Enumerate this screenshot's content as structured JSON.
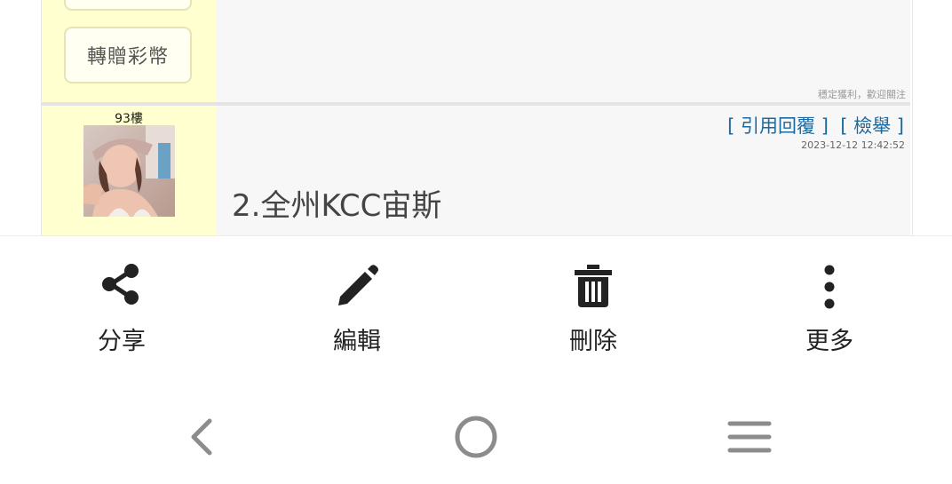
{
  "post_above": {
    "transfer_button": "轉贈彩幣",
    "signature": "穩定獲利，歡迎關注"
  },
  "post": {
    "floor": "93樓",
    "quote_reply": "引用回覆",
    "report": "檢舉",
    "timestamp": "2023-12-12 12:42:52",
    "content": "2.全州KCC宙斯"
  },
  "action_sheet": {
    "items": [
      {
        "label": "分享",
        "icon": "share-icon"
      },
      {
        "label": "編輯",
        "icon": "pencil-icon"
      },
      {
        "label": "刪除",
        "icon": "trash-icon"
      },
      {
        "label": "更多",
        "icon": "more-vertical-icon"
      }
    ]
  },
  "navigation": {
    "buttons": [
      "back-icon",
      "home-icon",
      "recents-icon"
    ]
  },
  "colors": {
    "sidebar_bg": "#ffffd0",
    "post_bg": "#f7f7f7",
    "link": "#1a6aa0"
  }
}
